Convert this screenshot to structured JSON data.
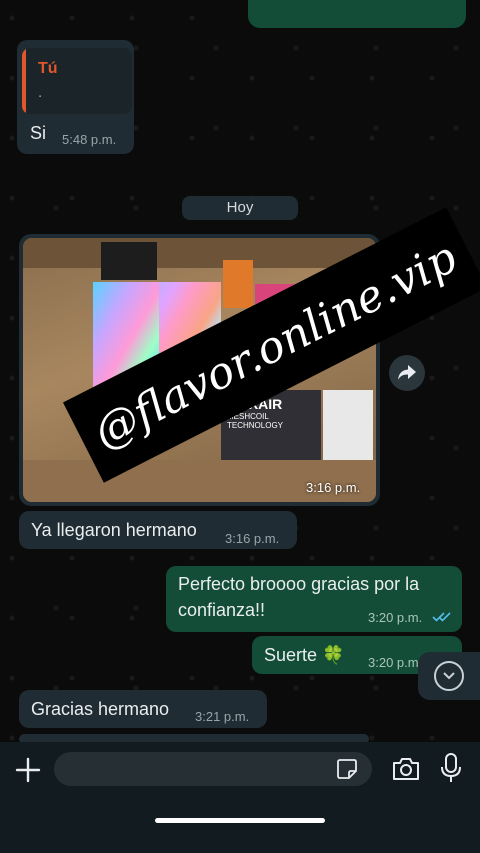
{
  "chat": {
    "reply": {
      "quote_author": "Tú",
      "quote_text": ".",
      "text": "Si",
      "time": "5:48 p.m."
    },
    "date_separator": "Hoy",
    "image_message": {
      "watermark": "@flavor.online.vip",
      "time": "3:16 p.m.",
      "box_labels": [
        "MAXAIR",
        "MESHCOIL TECHNOLOGY"
      ]
    },
    "messages": [
      {
        "direction": "in",
        "text": "Ya llegaron hermano",
        "time": "3:16 p.m."
      },
      {
        "direction": "out",
        "text_line1": "Perfecto broooo gracias por la",
        "text_line2": "confianza!!",
        "time": "3:20 p.m."
      },
      {
        "direction": "out",
        "text": "Suerte 🍀",
        "time": "3:20 p.m."
      },
      {
        "direction": "in",
        "text": "Gracias hermano",
        "time": "3:21 p.m."
      }
    ]
  },
  "input": {
    "placeholder": "",
    "value": ""
  },
  "icons": [
    "plus-icon",
    "sticker-icon",
    "camera-icon",
    "microphone-icon",
    "forward-icon",
    "chevron-down-icon",
    "double-check-icon"
  ],
  "colors": {
    "incoming_bubble": "#1f2c33",
    "outgoing_bubble": "#134d37",
    "read_ticks": "#53bdeb",
    "quote_accent": "#e2562c"
  }
}
